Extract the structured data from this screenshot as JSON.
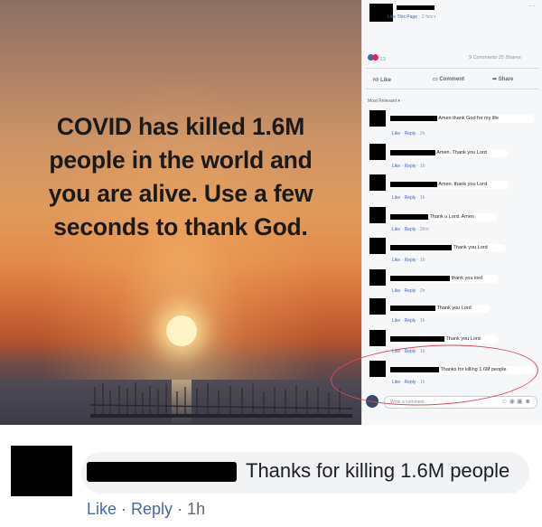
{
  "image": {
    "caption": "COVID has killed 1.6M people in the world and you are alive. Use a few seconds to thank God."
  },
  "post": {
    "page_link": "Like This Page",
    "time": "2 hrs",
    "reactions_count": "13",
    "comments_shares": "9 Comments 25 Shares",
    "like_label": "Like",
    "comment_label": "Comment",
    "share_label": "Share",
    "sort_label": "Most Relevant"
  },
  "comments": [
    {
      "text": "Amen thank God for my life",
      "time": "2h"
    },
    {
      "text": "Amen. Thank you Lord",
      "time": "1h"
    },
    {
      "text": "Amen. thank you Lord",
      "time": "1h"
    },
    {
      "text": "Thank u Lord. Amen",
      "time": "36m"
    },
    {
      "text": "Thank you Lord",
      "time": "1h"
    },
    {
      "text": "thank you lord",
      "time": "2h"
    },
    {
      "text": "Thank you Lord",
      "time": "1h"
    },
    {
      "text": "Thank you Lord",
      "time": "1h"
    },
    {
      "text": "Thanks for killing 1.6M people",
      "time": "1h"
    }
  ],
  "comment_actions": {
    "like": "Like",
    "reply": "Reply"
  },
  "write_placeholder": "Write a comment...",
  "zoomed_comment": {
    "text": "Thanks for killing 1.6M people",
    "like": "Like",
    "reply": "Reply",
    "time": "1h"
  },
  "colors": {
    "link": "#4267b2",
    "highlight": "#d94b5a"
  }
}
